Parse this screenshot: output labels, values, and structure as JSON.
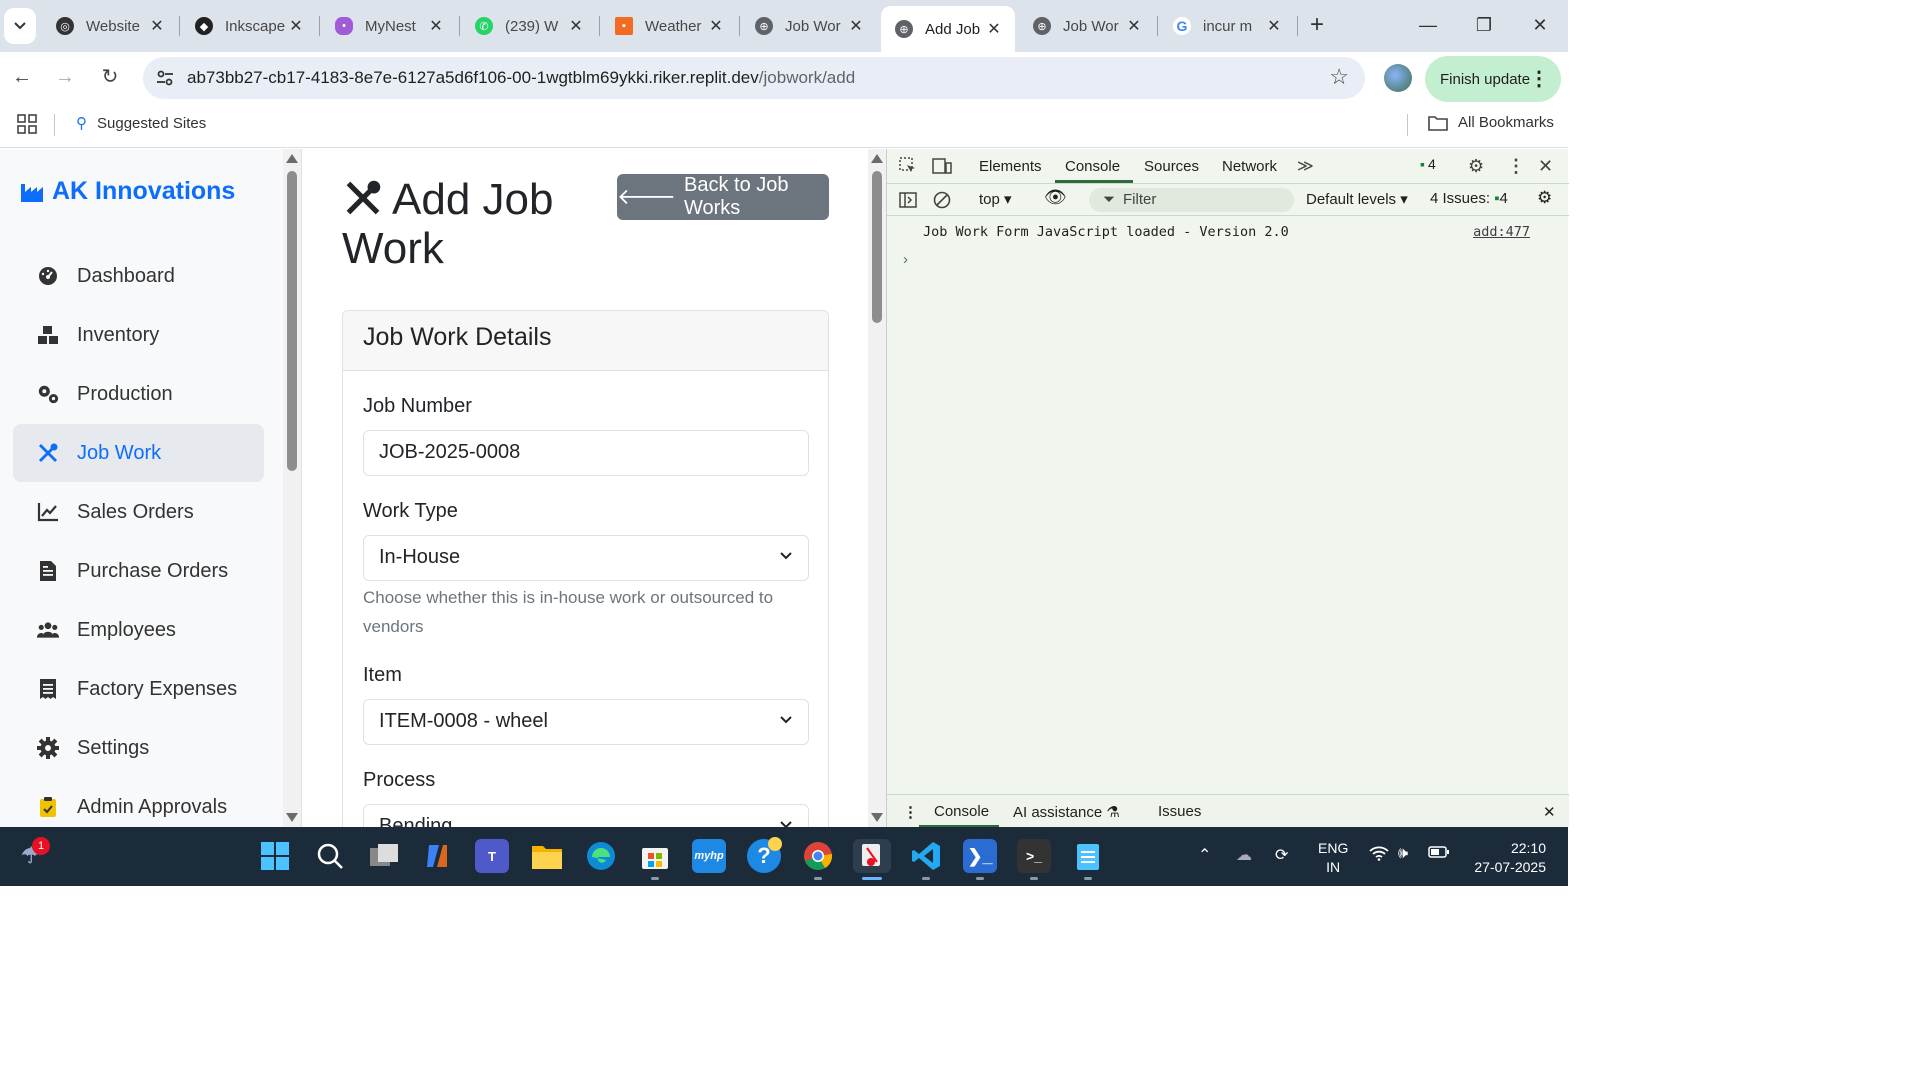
{
  "browser": {
    "tabs": [
      {
        "title": "Website",
        "favicon_color": "#333333"
      },
      {
        "title": "Inkscape",
        "favicon_color": "#222222"
      },
      {
        "title": "MyNest",
        "favicon_color": "#a05bd6"
      },
      {
        "title": "(239) W",
        "favicon_color": "#25d366"
      },
      {
        "title": "Weather",
        "favicon_color": "#f26b21"
      },
      {
        "title": "Job Wor",
        "favicon_color": "#5f6368"
      },
      {
        "title": "Add Job",
        "favicon_color": "#5f6368"
      },
      {
        "title": "Job Wor",
        "favicon_color": "#5f6368"
      },
      {
        "title": "incur m",
        "favicon_color": "#4285f4"
      }
    ],
    "url_host": "ab73bb27-cb17-4183-8e7e-6127a5d6f106-00-1wgtblm69ykki.riker.replit.dev",
    "url_path": "/jobwork/add",
    "finish_update_label": "Finish update",
    "bookmarks": {
      "suggested": "Suggested Sites",
      "all": "All Bookmarks"
    }
  },
  "app": {
    "brand": "AK Innovations",
    "nav": [
      {
        "label": "Dashboard",
        "icon": "dashboard-icon",
        "active": false
      },
      {
        "label": "Inventory",
        "icon": "boxes-icon",
        "active": false
      },
      {
        "label": "Production",
        "icon": "gears-icon",
        "active": false
      },
      {
        "label": "Job Work",
        "icon": "tools-icon",
        "active": true
      },
      {
        "label": "Sales Orders",
        "icon": "chart-line-icon",
        "active": false
      },
      {
        "label": "Purchase Orders",
        "icon": "file-invoice-icon",
        "active": false
      },
      {
        "label": "Employees",
        "icon": "users-icon",
        "active": false
      },
      {
        "label": "Factory Expenses",
        "icon": "receipt-icon",
        "active": false
      },
      {
        "label": "Settings",
        "icon": "gear-icon",
        "active": false
      },
      {
        "label": "Admin Approvals",
        "icon": "clipboard-check-icon",
        "active": false
      }
    ],
    "page_title": "Add Job Work",
    "back_button": "Back to Job Works",
    "card_title": "Job Work Details",
    "form": {
      "job_number_label": "Job Number",
      "job_number_value": "JOB-2025-0008",
      "work_type_label": "Work Type",
      "work_type_value": "In-House",
      "work_type_help": "Choose whether this is in-house work or outsourced to vendors",
      "item_label": "Item",
      "item_value": "ITEM-0008 - wheel",
      "process_label": "Process",
      "process_value": "Bending"
    }
  },
  "devtools": {
    "tabs": [
      "Elements",
      "Console",
      "Sources",
      "Network"
    ],
    "active_tab": "Console",
    "message_count": "4",
    "context": "top",
    "filter_placeholder": "Filter",
    "levels": "Default levels",
    "issues_label": "4 Issues:",
    "issues_count": "4",
    "log_message": "Job Work Form JavaScript loaded - Version 2.0",
    "log_source": "add:477",
    "drawer_tabs": [
      "Console",
      "AI assistance",
      "Issues"
    ]
  },
  "taskbar": {
    "weather_badge": "1",
    "lang_line1": "ENG",
    "lang_line2": "IN",
    "time": "22:10",
    "date": "27-07-2025"
  }
}
